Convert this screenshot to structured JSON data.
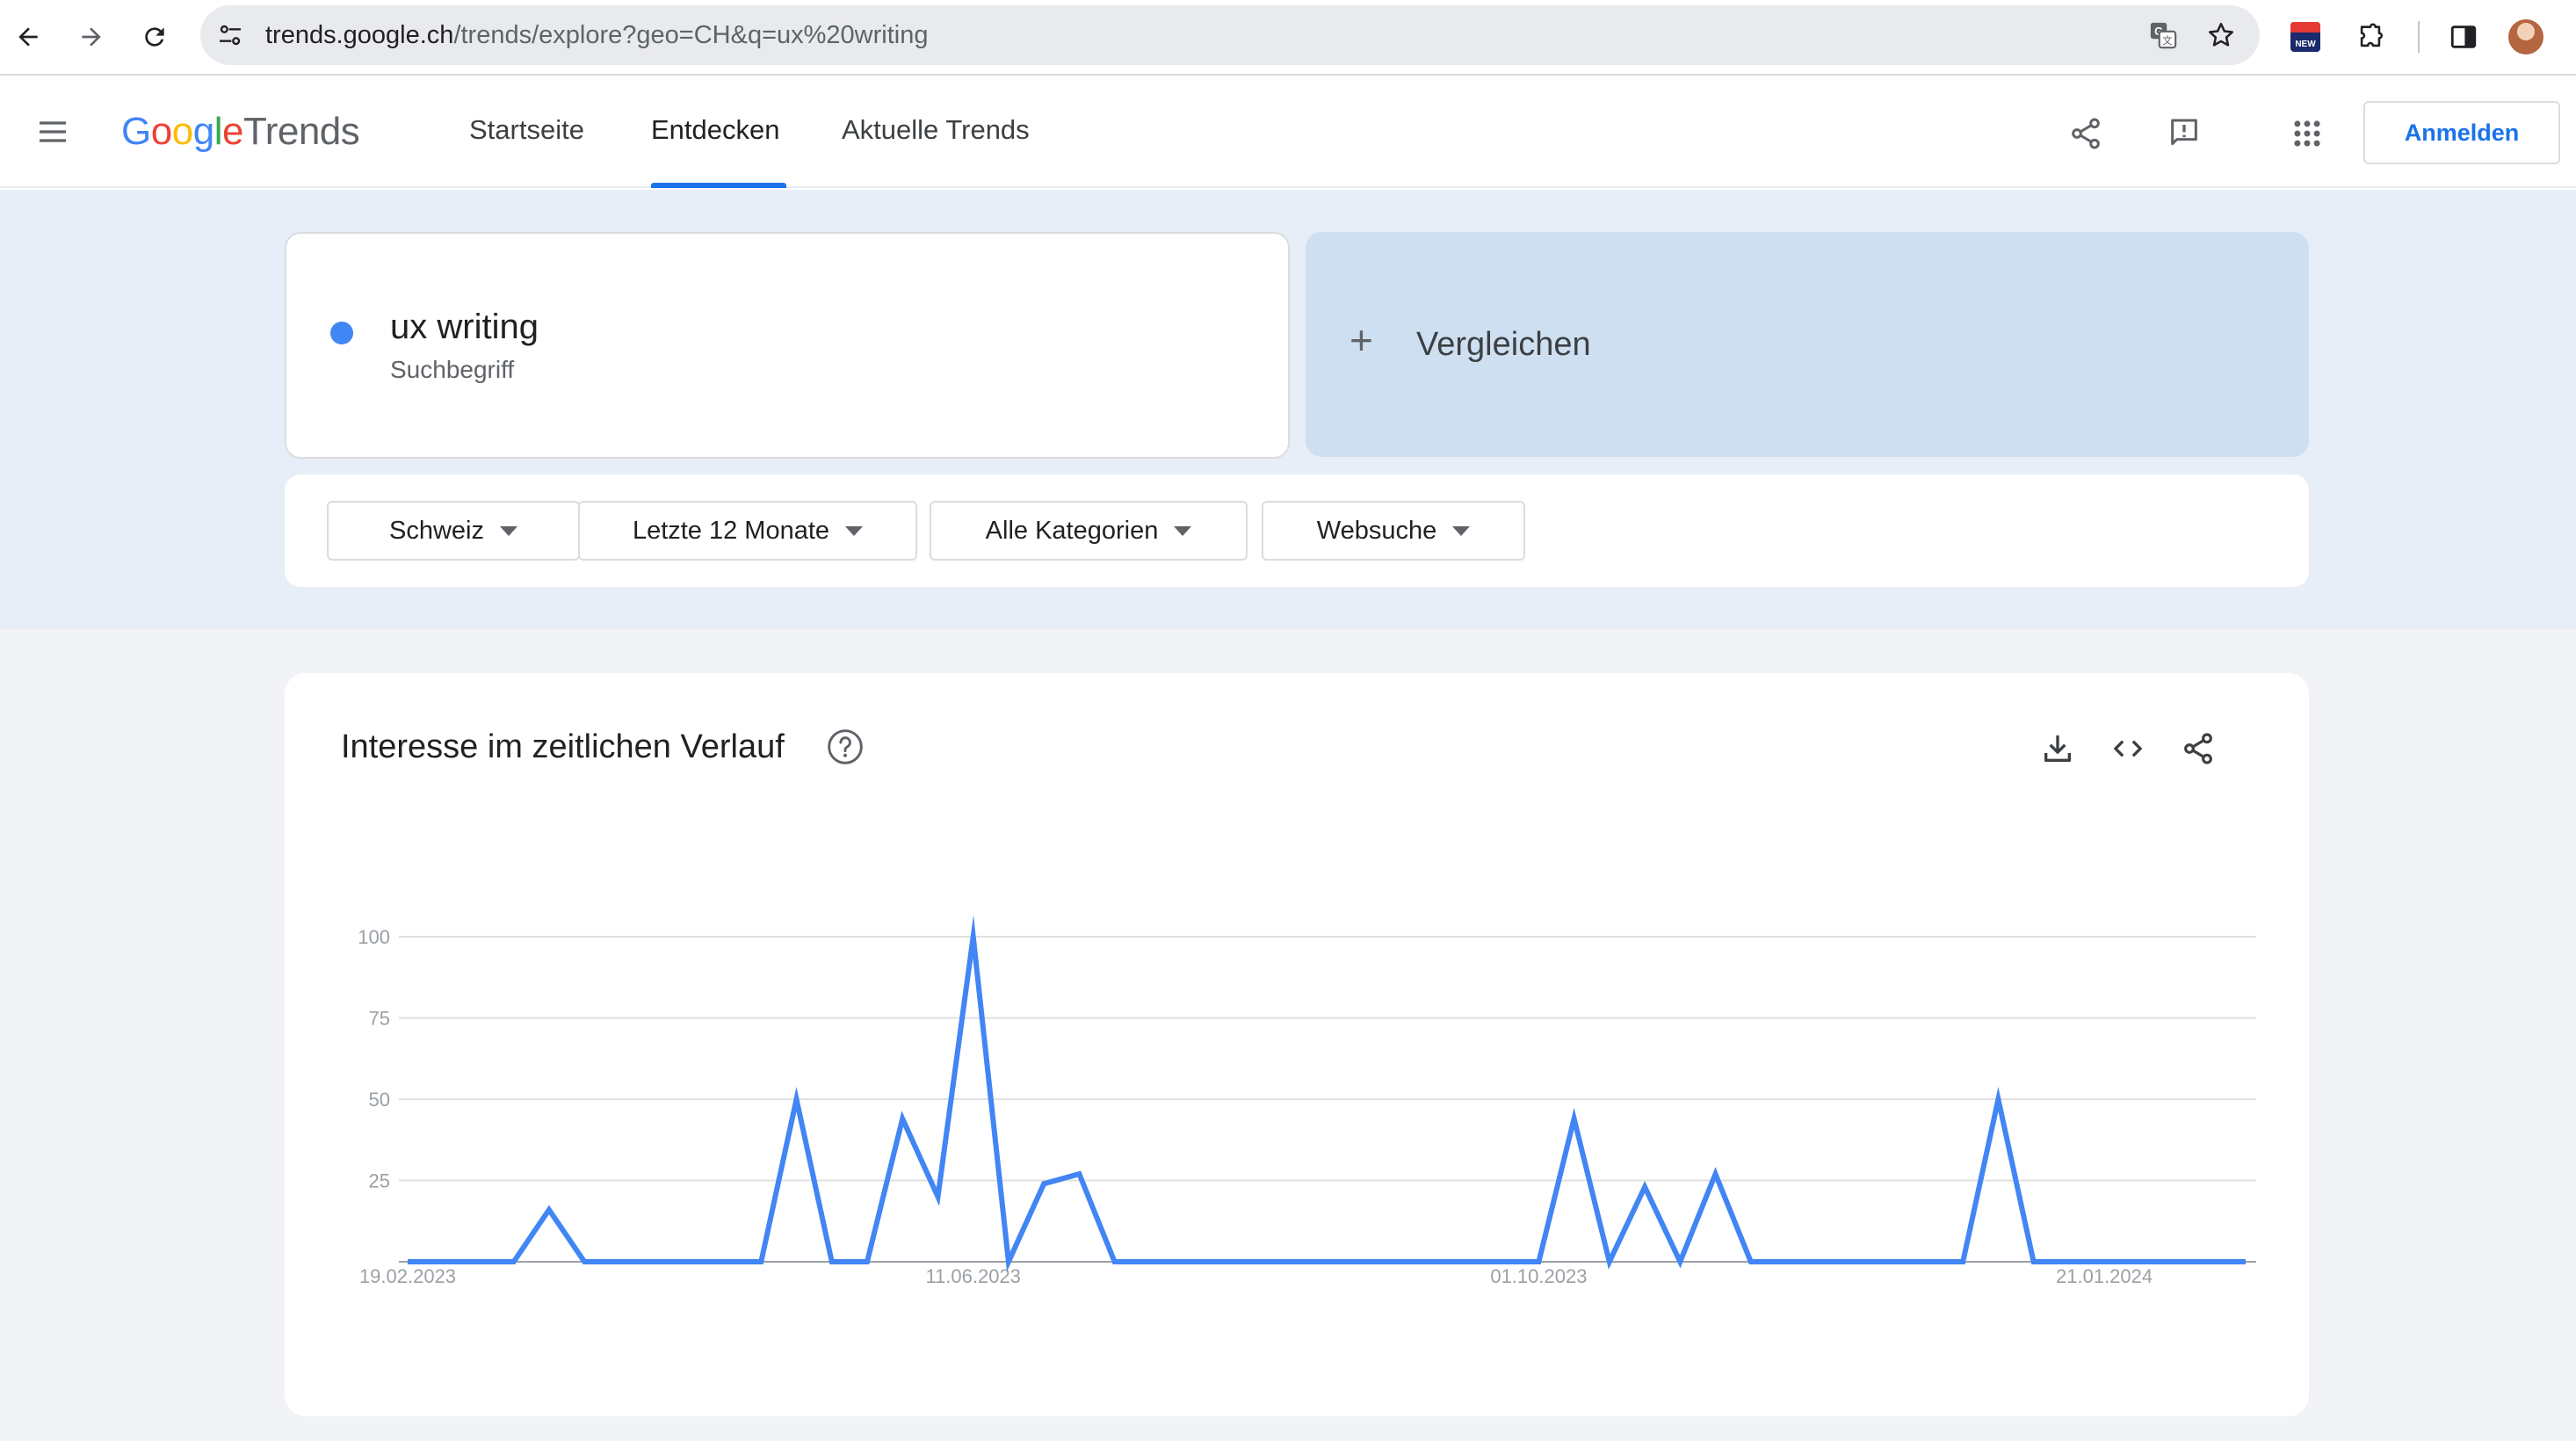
{
  "browser": {
    "url_host": "trends.google.ch",
    "url_path": "/trends/explore?geo=CH&q=ux%20writing",
    "icons": [
      "back-icon",
      "forward-icon",
      "reload-icon",
      "site-settings-icon",
      "translate-icon",
      "bookmark-star-icon",
      "news-extension-icon",
      "extensions-puzzle-icon",
      "side-panel-icon",
      "profile-avatar"
    ],
    "news_badge": "NEW"
  },
  "header": {
    "logo_google": "Google",
    "logo_trends": "Trends",
    "tabs": [
      {
        "label": "Startseite"
      },
      {
        "label": "Entdecken"
      },
      {
        "label": "Aktuelle Trends"
      }
    ],
    "active_tab": "Entdecken",
    "signin_label": "Anmelden",
    "icons": [
      "share-icon",
      "feedback-icon",
      "apps-grid-icon",
      "menu-icon"
    ]
  },
  "search": {
    "term": "ux writing",
    "term_type": "Suchbegriff",
    "term_color": "#4285f4",
    "compare_label": "Vergleichen",
    "filters": [
      {
        "label": "Schweiz"
      },
      {
        "label": "Letzte 12 Monate"
      },
      {
        "label": "Alle Kategorien"
      },
      {
        "label": "Websuche"
      }
    ]
  },
  "chart_card": {
    "title": "Interesse im zeitlichen Verlauf",
    "icons": [
      "help-icon",
      "download-icon",
      "embed-code-icon",
      "share-icon"
    ]
  },
  "chart_data": {
    "type": "line",
    "title": "Interesse im zeitlichen Verlauf",
    "xlabel": "",
    "ylabel": "",
    "ylim": [
      0,
      100
    ],
    "yticks": [
      25,
      50,
      75,
      100
    ],
    "grid": true,
    "x_tick_labels": [
      "19.02.2023",
      "11.06.2023",
      "01.10.2023",
      "21.01.2024"
    ],
    "x_tick_indices": [
      0,
      16,
      32,
      48
    ],
    "line_color": "#4285f4",
    "series": [
      {
        "values": [
          0,
          0,
          0,
          0,
          16,
          0,
          0,
          0,
          0,
          0,
          0,
          50,
          0,
          0,
          44,
          20,
          100,
          0,
          24,
          27,
          0,
          0,
          0,
          0,
          0,
          0,
          0,
          0,
          0,
          0,
          0,
          0,
          0,
          44,
          0,
          23,
          0,
          27,
          0,
          0,
          0,
          0,
          0,
          0,
          0,
          50,
          0,
          0,
          0,
          0,
          0,
          0,
          0
        ]
      }
    ]
  }
}
